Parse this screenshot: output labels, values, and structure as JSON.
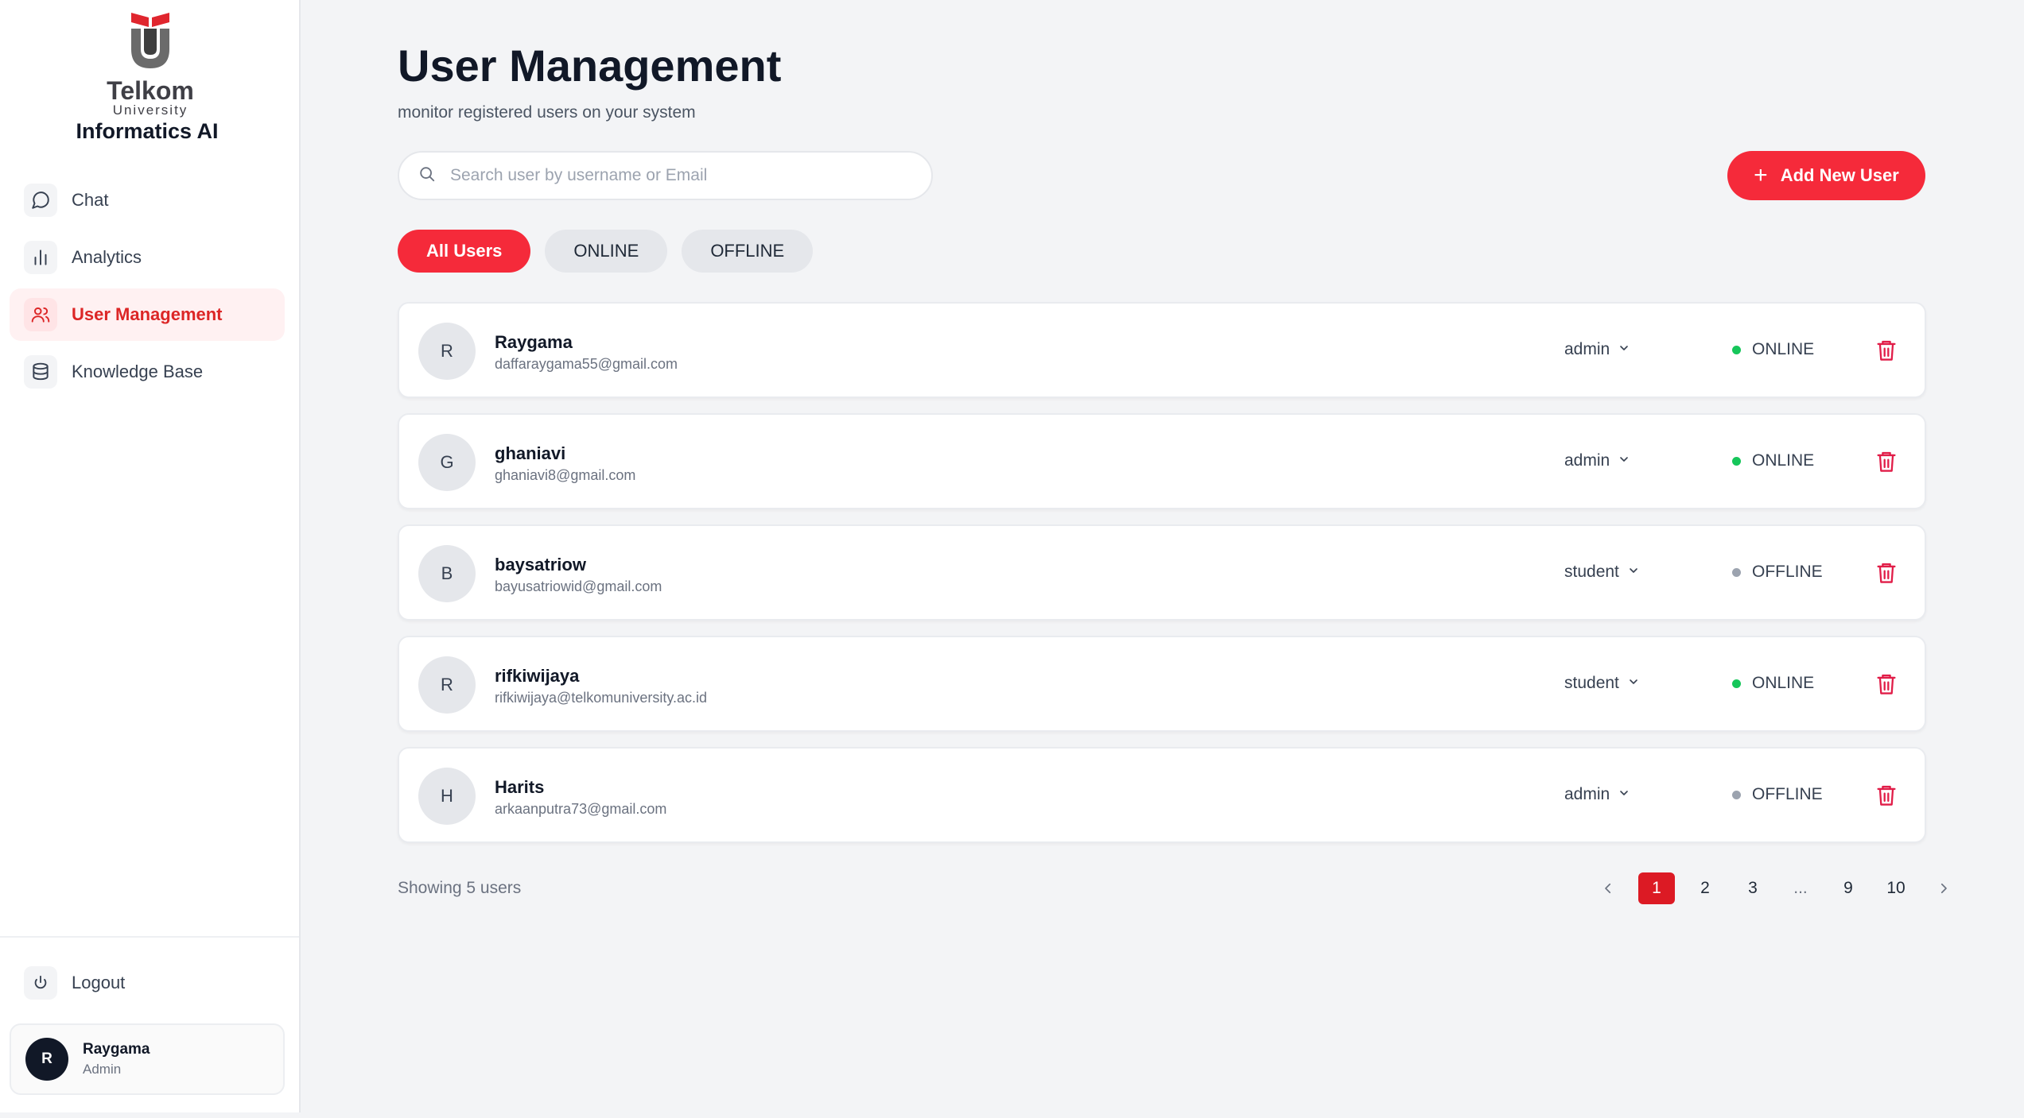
{
  "sidebar": {
    "logo": {
      "word": "Telkom",
      "sub": "University"
    },
    "brand": "Informatics AI",
    "nav": [
      {
        "label": "Chat",
        "icon": "chat-icon"
      },
      {
        "label": "Analytics",
        "icon": "bar-chart-icon"
      },
      {
        "label": "User Management",
        "icon": "users-icon",
        "active": true
      },
      {
        "label": "Knowledge Base",
        "icon": "database-icon"
      }
    ],
    "logout_label": "Logout",
    "user": {
      "initial": "R",
      "name": "Raygama",
      "role": "Admin"
    }
  },
  "header": {
    "title": "User Management",
    "subtitle": "monitor registered users on your system"
  },
  "search": {
    "placeholder": "Search user by username or Email",
    "value": ""
  },
  "add_button": {
    "label": "Add New User"
  },
  "filters": [
    {
      "label": "All Users",
      "active": true
    },
    {
      "label": "ONLINE",
      "active": false
    },
    {
      "label": "OFFLINE",
      "active": false
    }
  ],
  "users": [
    {
      "initial": "R",
      "name": "Raygama",
      "email": "daffaraygama55@gmail.com",
      "role": "admin",
      "status": "ONLINE"
    },
    {
      "initial": "G",
      "name": "ghaniavi",
      "email": "ghaniavi8@gmail.com",
      "role": "admin",
      "status": "ONLINE"
    },
    {
      "initial": "B",
      "name": "baysatriow",
      "email": "bayusatriowid@gmail.com",
      "role": "student",
      "status": "OFFLINE"
    },
    {
      "initial": "R",
      "name": "rifkiwijaya",
      "email": "rifkiwijaya@telkomuniversity.ac.id",
      "role": "student",
      "status": "ONLINE"
    },
    {
      "initial": "H",
      "name": "Harits",
      "email": "arkaanputra73@gmail.com",
      "role": "admin",
      "status": "OFFLINE"
    }
  ],
  "footer": {
    "showing": "Showing 5 users"
  },
  "pagination": {
    "pages": [
      "1",
      "2",
      "3",
      "...",
      "9",
      "10"
    ],
    "current": "1"
  },
  "colors": {
    "accent": "#f52a3a",
    "online": "#16c65a",
    "offline": "#9ca3af",
    "danger": "#e11d48"
  }
}
